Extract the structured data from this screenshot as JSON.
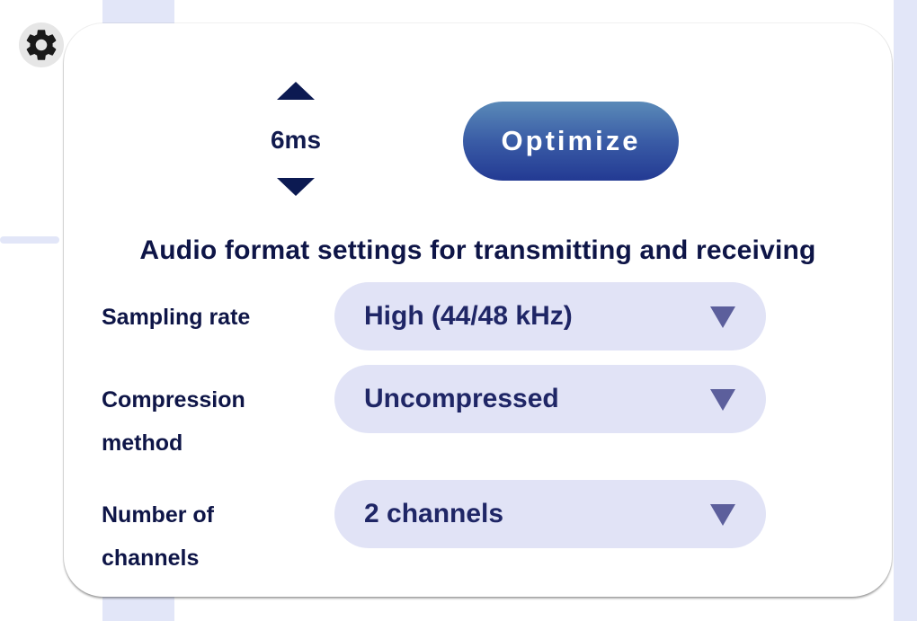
{
  "latency": {
    "value": "6ms"
  },
  "optimize_button": {
    "label": "Optimize"
  },
  "section": {
    "title": "Audio format settings for transmitting and receiving"
  },
  "fields": [
    {
      "label": "Sampling rate",
      "value": "High (44/48 kHz)"
    },
    {
      "label": "Compression method",
      "value": "Uncompressed"
    },
    {
      "label": "Number of channels",
      "value": "2 channels"
    }
  ],
  "icons": {
    "settings": "gear-icon",
    "increase": "triangle-up-icon",
    "decrease": "triangle-down-icon",
    "dropdown": "caret-down-icon"
  },
  "colors": {
    "accent_dark": "#0c1a52",
    "button_gradient_top": "#5a8ab8",
    "button_gradient_bottom": "#233a93",
    "dropdown_bg": "#e1e3f6",
    "background_accent": "#e2e6f8"
  }
}
